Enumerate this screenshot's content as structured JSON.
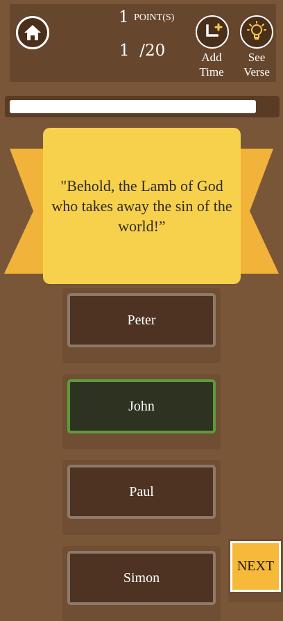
{
  "header": {
    "points_value": "1",
    "points_label": "POINT(S)",
    "progress": "1  /20",
    "add_time_label_line1": "Add",
    "add_time_label_line2": "Time",
    "see_verse_label_line1": "See",
    "see_verse_label_line2": "Verse"
  },
  "timer": {
    "remaining_fraction": 0.93
  },
  "question": {
    "text": "\"Behold, the Lamb of God who takes away the sin of the world!”"
  },
  "answers": [
    {
      "label": "Peter",
      "state": "default"
    },
    {
      "label": "John",
      "state": "correct"
    },
    {
      "label": "Paul",
      "state": "default"
    },
    {
      "label": "Simon",
      "state": "default"
    }
  ],
  "next_label": "NEXT",
  "colors": {
    "background": "#7a5638",
    "panel": "#66462c",
    "card": "#f7d14c",
    "ribbon": "#f2b33a",
    "correct_border": "#5e9a3c",
    "next_button": "#f7b93a"
  },
  "icons": {
    "home": "home-icon",
    "add_time": "timer-plus-icon",
    "see_verse": "lightbulb-icon"
  }
}
